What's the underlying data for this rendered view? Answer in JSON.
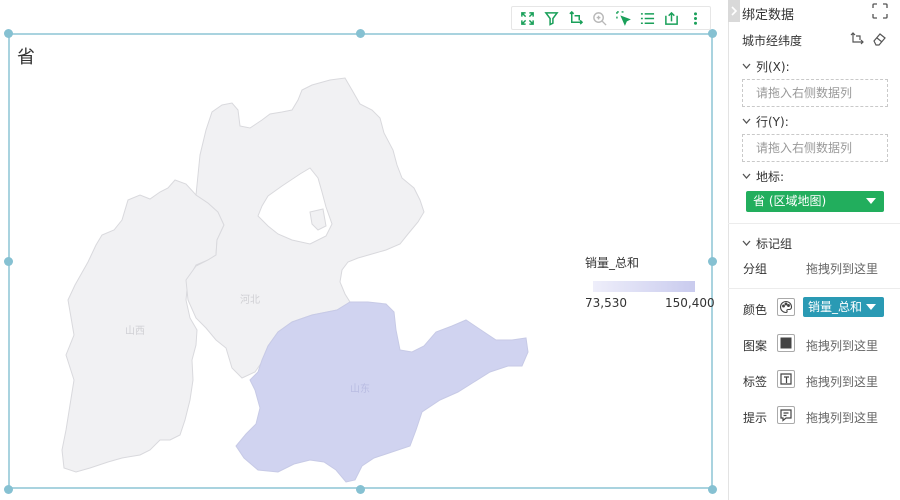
{
  "toolbar": {
    "icons": [
      "expand-icon",
      "filter-icon",
      "swap-axes-icon",
      "zoom-icon",
      "select-icon",
      "list-icon",
      "export-icon",
      "more-icon"
    ]
  },
  "chart": {
    "title": "省",
    "legend_title": "销量_总和",
    "legend_min": "73,530",
    "legend_max": "150,400",
    "region_labels": [
      "山西",
      "河北",
      "山东"
    ],
    "colors": {
      "highlight": "#d0d3f0",
      "base": "#f1f1f3",
      "stroke": "#d9d9dd",
      "frame": "#a9d3df"
    }
  },
  "chart_data": {
    "type": "map",
    "title": "省",
    "legend": {
      "title": "销量_总和",
      "min": 73530,
      "max": 150400
    },
    "regions": [
      {
        "name": "山西"
      },
      {
        "name": "河北"
      },
      {
        "name": "山东"
      }
    ]
  },
  "panel": {
    "title": "绑定数据",
    "coord_label": "城市经纬度",
    "column_label": "列(X):",
    "column_placeholder": "请拖入右侧数据列",
    "row_label": "行(Y):",
    "row_placeholder": "请拖入右侧数据列",
    "geo_label": "地标:",
    "geo_value": "省 (区域地图)",
    "mark_group_label": "标记组",
    "group_label": "分组",
    "group_hint": "拖拽列到这里",
    "color_label": "颜色",
    "color_value": "销量_总和",
    "pattern_label": "图案",
    "pattern_hint": "拖拽列到这里",
    "tag_label": "标签",
    "tag_hint": "拖拽列到这里",
    "tooltip_label": "提示",
    "tooltip_hint": "拖拽列到这里"
  }
}
